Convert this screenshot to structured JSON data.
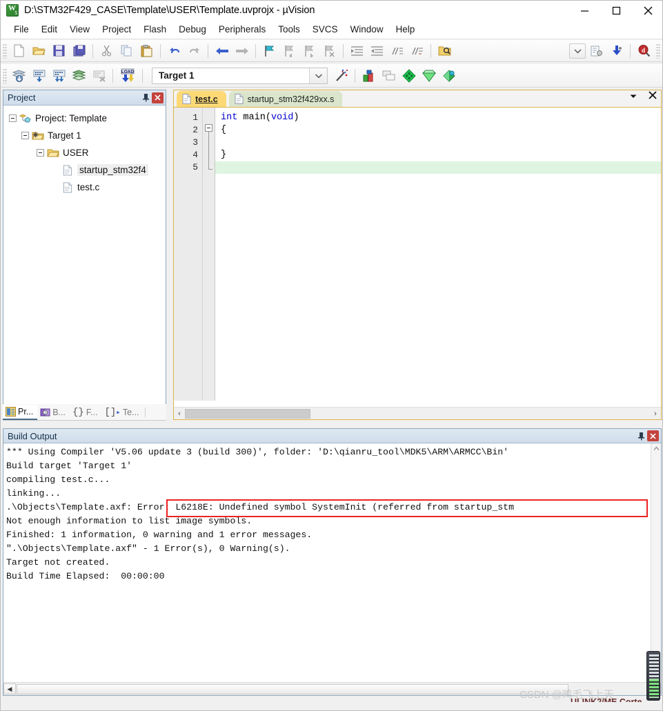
{
  "window": {
    "title": "D:\\STM32F429_CASE\\Template\\USER\\Template.uvprojx - µVision",
    "icon": "keil-uvision-icon",
    "minimize_label": "Minimize",
    "maximize_label": "Maximize",
    "close_label": "Close"
  },
  "menubar": {
    "items": [
      {
        "label": "File"
      },
      {
        "label": "Edit"
      },
      {
        "label": "View"
      },
      {
        "label": "Project"
      },
      {
        "label": "Flash"
      },
      {
        "label": "Debug"
      },
      {
        "label": "Peripherals"
      },
      {
        "label": "Tools"
      },
      {
        "label": "SVCS"
      },
      {
        "label": "Window"
      },
      {
        "label": "Help"
      }
    ]
  },
  "toolbar_main": {
    "items": [
      {
        "icon": "new-file-icon",
        "title": "New"
      },
      {
        "icon": "open-folder-icon",
        "title": "Open"
      },
      {
        "icon": "save-icon",
        "title": "Save"
      },
      {
        "icon": "save-all-icon",
        "title": "Save All"
      },
      {
        "icon": "cut-icon",
        "title": "Cut"
      },
      {
        "icon": "copy-icon",
        "title": "Copy"
      },
      {
        "icon": "paste-icon",
        "title": "Paste"
      },
      {
        "icon": "undo-icon",
        "title": "Undo"
      },
      {
        "icon": "redo-icon",
        "title": "Redo"
      },
      {
        "icon": "navigate-back-icon",
        "title": "Back"
      },
      {
        "icon": "navigate-forward-icon",
        "title": "Forward"
      },
      {
        "icon": "bookmark-toggle-icon",
        "title": "Toggle Bookmark"
      },
      {
        "icon": "bookmark-prev-icon",
        "title": "Previous Bookmark"
      },
      {
        "icon": "bookmark-next-icon",
        "title": "Next Bookmark"
      },
      {
        "icon": "bookmark-clear-icon",
        "title": "Clear Bookmarks"
      },
      {
        "icon": "indent-icon",
        "title": "Indent"
      },
      {
        "icon": "outdent-icon",
        "title": "Outdent"
      },
      {
        "icon": "comment-icon",
        "title": "Comment"
      },
      {
        "icon": "uncomment-icon",
        "title": "Uncomment"
      },
      {
        "icon": "find-in-files-icon",
        "title": "Find in Files"
      }
    ],
    "right_items": [
      {
        "icon": "chevron-down-icon",
        "title": "More"
      },
      {
        "icon": "configure-icon",
        "title": "Configure"
      },
      {
        "icon": "debug-download-icon",
        "title": "Download"
      },
      {
        "icon": "help-search-icon",
        "title": "Help"
      }
    ]
  },
  "toolbar_build": {
    "items": [
      {
        "icon": "translate-icon",
        "title": "Translate"
      },
      {
        "icon": "build-icon",
        "title": "Build"
      },
      {
        "icon": "rebuild-icon",
        "title": "Rebuild"
      },
      {
        "icon": "batch-build-icon",
        "title": "Batch Build"
      },
      {
        "icon": "stop-build-icon",
        "title": "Stop Build"
      },
      {
        "icon": "load-icon",
        "title": "Download"
      }
    ],
    "target": {
      "value": "Target 1",
      "dropdown_icon": "chevron-down-icon"
    },
    "right_items": [
      {
        "icon": "magic-wand-icon",
        "title": "Options for Target"
      },
      {
        "icon": "manage-project-icon",
        "title": "Manage Project Items"
      },
      {
        "icon": "multi-project-icon",
        "title": "Manage Multi-Project"
      },
      {
        "icon": "pack-installer-icon",
        "title": "Pack Installer"
      },
      {
        "icon": "run-time-env-icon",
        "title": "Manage Run-Time Environment"
      },
      {
        "icon": "software-packs-icon",
        "title": "Select Software Packs"
      }
    ]
  },
  "project_panel": {
    "title": "Project",
    "pin_icon": "pin-icon",
    "close_icon": "close-icon",
    "tree": [
      {
        "label": "Project: Template",
        "icon": "project-icon",
        "depth": 0,
        "expanded": true,
        "selected": false
      },
      {
        "label": "Target 1",
        "icon": "target-icon",
        "depth": 1,
        "expanded": true,
        "selected": false
      },
      {
        "label": "USER",
        "icon": "folder-icon",
        "depth": 2,
        "expanded": true,
        "selected": false
      },
      {
        "label": "startup_stm32f4",
        "icon": "file-icon",
        "depth": 3,
        "expanded": false,
        "selected": true
      },
      {
        "label": "test.c",
        "icon": "file-icon",
        "depth": 3,
        "expanded": false,
        "selected": false
      }
    ],
    "scroll": {
      "left_arrow": "◀",
      "right_arrow": "▶"
    },
    "tabs": [
      {
        "label": "Pr...",
        "icon": "project-tab-icon",
        "active": true
      },
      {
        "label": "B...",
        "icon": "books-tab-icon",
        "active": false
      },
      {
        "label": "F...",
        "icon": "functions-tab-icon",
        "active": false
      },
      {
        "label": "Te...",
        "icon": "templates-tab-icon",
        "active": false
      }
    ]
  },
  "editor": {
    "tabs": [
      {
        "label": "test.c",
        "icon": "c-file-icon",
        "active": true
      },
      {
        "label": "startup_stm32f429xx.s",
        "icon": "asm-file-icon",
        "active": false
      }
    ],
    "window_dropdown_icon": "chevron-down-icon",
    "window_close_icon": "close-icon",
    "line_numbers": [
      "1",
      "2",
      "3",
      "4",
      "5"
    ],
    "code_lines": [
      {
        "num": "1",
        "tokens": [
          {
            "t": "int",
            "c": "kw"
          },
          {
            "t": " main",
            "c": "punct"
          },
          {
            "t": "(",
            "c": "punct"
          },
          {
            "t": "void",
            "c": "kw"
          },
          {
            "t": ")",
            "c": "punct"
          }
        ],
        "highlight": false
      },
      {
        "num": "2",
        "tokens": [
          {
            "t": "{",
            "c": "punct"
          }
        ],
        "highlight": false
      },
      {
        "num": "3",
        "tokens": [
          {
            "t": "",
            "c": "punct"
          }
        ],
        "highlight": false
      },
      {
        "num": "4",
        "tokens": [
          {
            "t": "}",
            "c": "punct"
          }
        ],
        "highlight": false
      },
      {
        "num": "5",
        "tokens": [
          {
            "t": "",
            "c": "punct"
          }
        ],
        "highlight": true
      }
    ],
    "scroll": {
      "left_arrow": "‹",
      "right_arrow": "›"
    }
  },
  "build_output": {
    "title": "Build Output",
    "pin_icon": "pin-icon",
    "close_icon": "close-icon",
    "lines": [
      "*** Using Compiler 'V5.06 update 3 (build 300)', folder: 'D:\\qianru_tool\\MDK5\\ARM\\ARMCC\\Bin'",
      "Build target 'Target 1'",
      "compiling test.c...",
      "linking...",
      ".\\Objects\\Template.axf: Error: L6218E: Undefined symbol SystemInit (referred from startup_stm",
      "Not enough information to list image symbols.",
      "Finished: 1 information, 0 warning and 1 error messages.",
      "\".\\Objects\\Template.axf\" - 1 Error(s), 0 Warning(s).",
      "Target not created.",
      "Build Time Elapsed:  00:00:00"
    ],
    "error_highlight_color": "#ee2222",
    "scroll": {
      "up_arrow": "︿",
      "down_arrow": "﹀",
      "left_arrow": "◀",
      "right_arrow": "▶"
    }
  },
  "overlays": {
    "watermark": "CSDN @鸡毛飞上天",
    "status_text": "ULINK2/ME Corte",
    "battery_icon": "battery-indicator-icon"
  }
}
